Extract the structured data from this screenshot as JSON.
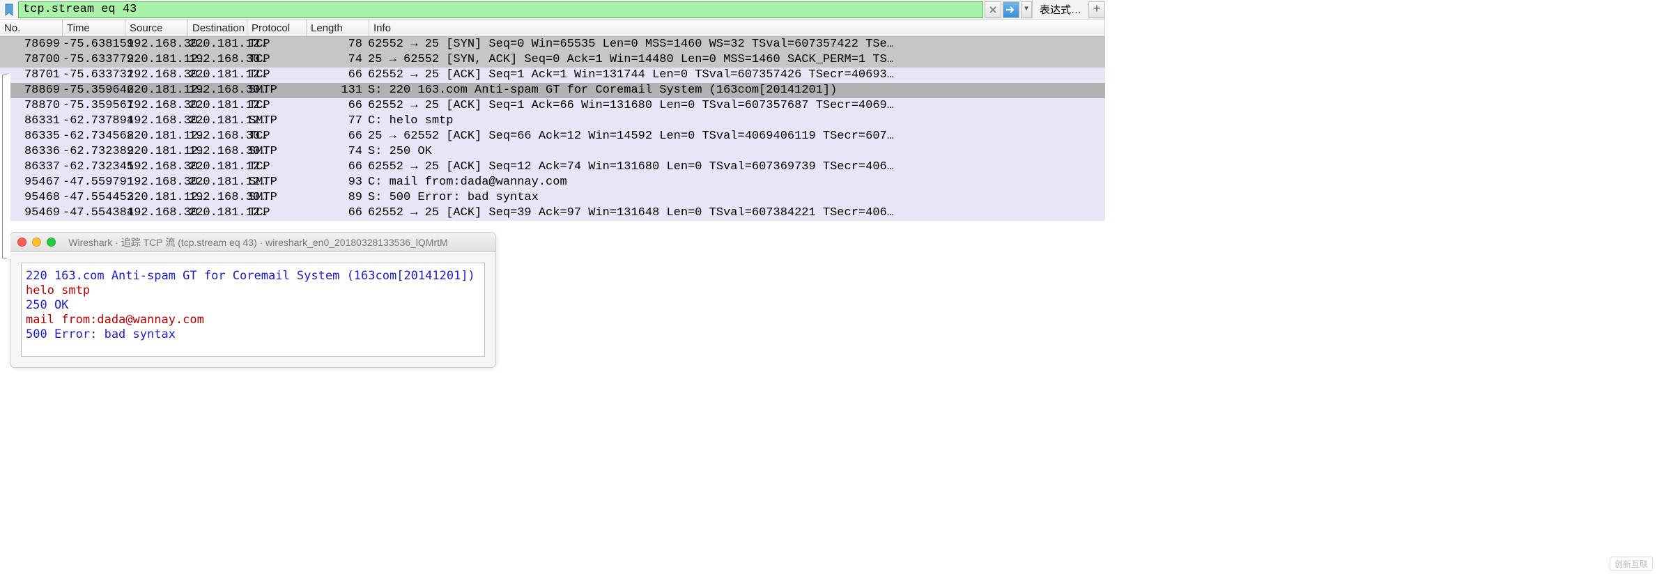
{
  "filter": {
    "value": "tcp.stream eq 43",
    "expr_button": "表达式…"
  },
  "columns": {
    "no": "No.",
    "time": "Time",
    "source": "Source",
    "destination": "Destination",
    "protocol": "Protocol",
    "length": "Length",
    "info": "Info"
  },
  "packets": [
    {
      "no": "78699",
      "time": "-75.638159",
      "src": "192.168.30…",
      "dst": "220.181.12…",
      "proto": "TCP",
      "len": "78",
      "info": "62552 → 25 [SYN] Seq=0 Win=65535 Len=0 MSS=1460 WS=32 TSval=607357422 TSe…",
      "style": "grey"
    },
    {
      "no": "78700",
      "time": "-75.633779",
      "src": "220.181.12…",
      "dst": "192.168.30…",
      "proto": "TCP",
      "len": "74",
      "info": "25 → 62552 [SYN, ACK] Seq=0 Ack=1 Win=14480 Len=0 MSS=1460 SACK_PERM=1 TS…",
      "style": "grey"
    },
    {
      "no": "78701",
      "time": "-75.633732",
      "src": "192.168.30…",
      "dst": "220.181.12…",
      "proto": "TCP",
      "len": "66",
      "info": "62552 → 25 [ACK] Seq=1 Ack=1 Win=131744 Len=0 TSval=607357426 TSecr=40693…",
      "style": "lav"
    },
    {
      "no": "78869",
      "time": "-75.359646",
      "src": "220.181.12…",
      "dst": "192.168.30…",
      "proto": "SMTP",
      "len": "131",
      "info": "S: 220 163.com Anti-spam GT for Coremail System (163com[20141201])",
      "style": "seldark"
    },
    {
      "no": "78870",
      "time": "-75.359567",
      "src": "192.168.30…",
      "dst": "220.181.12…",
      "proto": "TCP",
      "len": "66",
      "info": "62552 → 25 [ACK] Seq=1 Ack=66 Win=131680 Len=0 TSval=607357687 TSecr=4069…",
      "style": "lav"
    },
    {
      "no": "86331",
      "time": "-62.737894",
      "src": "192.168.30…",
      "dst": "220.181.12…",
      "proto": "SMTP",
      "len": "77",
      "info": "C: helo smtp",
      "style": "lav"
    },
    {
      "no": "86335",
      "time": "-62.734568",
      "src": "220.181.12…",
      "dst": "192.168.30…",
      "proto": "TCP",
      "len": "66",
      "info": "25 → 62552 [ACK] Seq=66 Ack=12 Win=14592 Len=0 TSval=4069406119 TSecr=607…",
      "style": "lav"
    },
    {
      "no": "86336",
      "time": "-62.732389",
      "src": "220.181.12…",
      "dst": "192.168.30…",
      "proto": "SMTP",
      "len": "74",
      "info": "S: 250 OK",
      "style": "lav"
    },
    {
      "no": "86337",
      "time": "-62.732345",
      "src": "192.168.30…",
      "dst": "220.181.12…",
      "proto": "TCP",
      "len": "66",
      "info": "62552 → 25 [ACK] Seq=12 Ack=74 Win=131680 Len=0 TSval=607369739 TSecr=406…",
      "style": "lav"
    },
    {
      "no": "95467",
      "time": "-47.559791",
      "src": "192.168.30…",
      "dst": "220.181.12…",
      "proto": "SMTP",
      "len": "93",
      "info": "C: mail from:dada@wannay.com",
      "style": "lav"
    },
    {
      "no": "95468",
      "time": "-47.554453",
      "src": "220.181.12…",
      "dst": "192.168.30…",
      "proto": "SMTP",
      "len": "89",
      "info": "S: 500 Error: bad syntax",
      "style": "lav"
    },
    {
      "no": "95469",
      "time": "-47.554384",
      "src": "192.168.30…",
      "dst": "220.181.12…",
      "proto": "TCP",
      "len": "66",
      "info": "62552 → 25 [ACK] Seq=39 Ack=97 Win=131648 Len=0 TSval=607384221 TSecr=406…",
      "style": "lav"
    }
  ],
  "follow_window": {
    "title": "Wireshark · 追踪 TCP 流 (tcp.stream eq 43) · wireshark_en0_20180328133536_lQMrtM",
    "lines": [
      {
        "text": "220 163.com Anti-spam GT for Coremail System (163com[20141201])",
        "dir": "server"
      },
      {
        "text": "helo smtp",
        "dir": "client"
      },
      {
        "text": "250 OK",
        "dir": "server"
      },
      {
        "text": "mail from:dada@wannay.com",
        "dir": "client"
      },
      {
        "text": "500 Error: bad syntax",
        "dir": "server"
      }
    ]
  },
  "watermark": "创新互联"
}
